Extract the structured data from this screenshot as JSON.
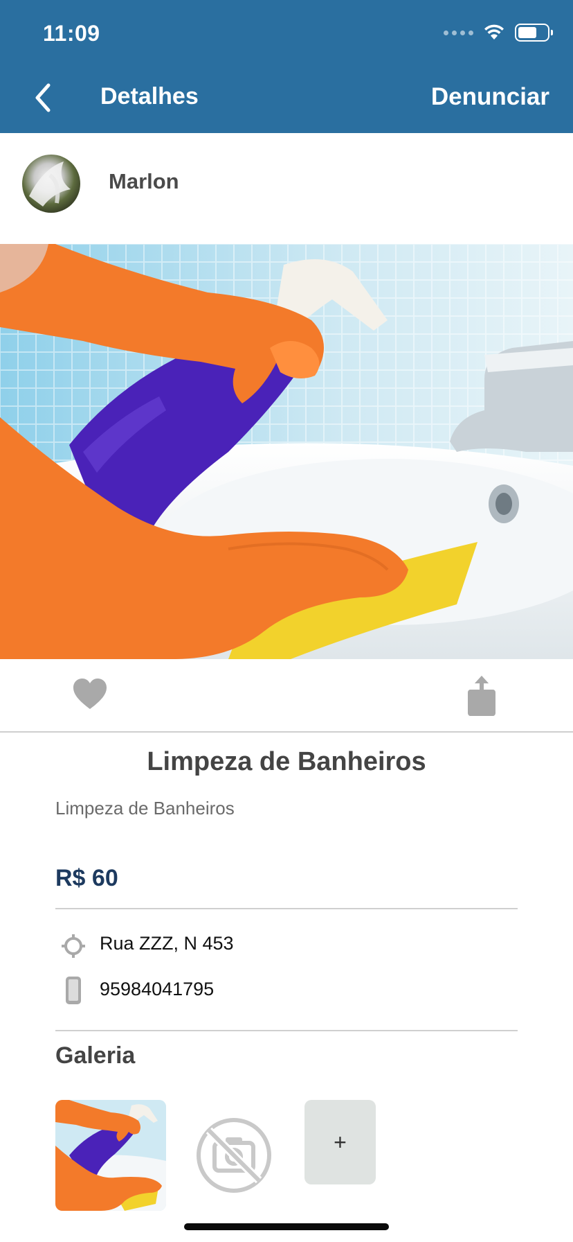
{
  "status_bar": {
    "time": "11:09"
  },
  "nav": {
    "back_icon": "chevron-left-icon",
    "title": "Detalhes",
    "report_label": "Denunciar"
  },
  "user": {
    "name": "Marlon"
  },
  "service": {
    "title": "Limpeza de Banheiros",
    "description": "Limpeza de Banheiros",
    "price": "R$ 60",
    "address": "Rua ZZZ, N 453",
    "phone": "95984041795"
  },
  "gallery": {
    "title": "Galeria",
    "add_label": "+"
  },
  "colors": {
    "header_bg": "#2a6fa0",
    "price_color": "#1d3a5f",
    "icon_gray": "#9a9a9a"
  }
}
